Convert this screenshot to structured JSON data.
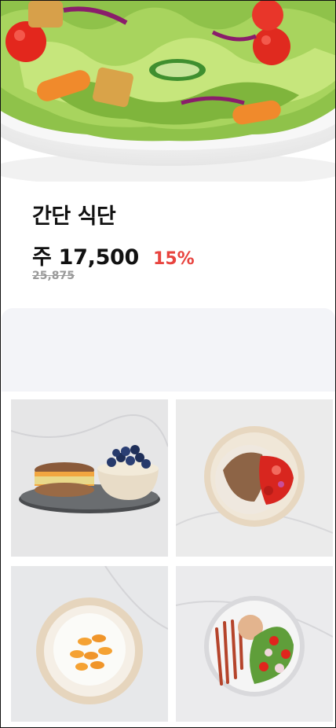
{
  "product": {
    "title": "간단 식단",
    "price": "주 17,500",
    "discount": "15%",
    "original_price": "25,875"
  },
  "gallery": {
    "items": [
      {
        "icon": "breakfast-sandwich-blueberries-icon"
      },
      {
        "icon": "turkey-rice-bowl-icon"
      },
      {
        "icon": "cottage-cheese-oranges-icon"
      },
      {
        "icon": "salmon-salad-plate-icon"
      }
    ]
  },
  "colors": {
    "accent_discount": "#e8443f",
    "panel_bg": "#f3f4f8"
  }
}
